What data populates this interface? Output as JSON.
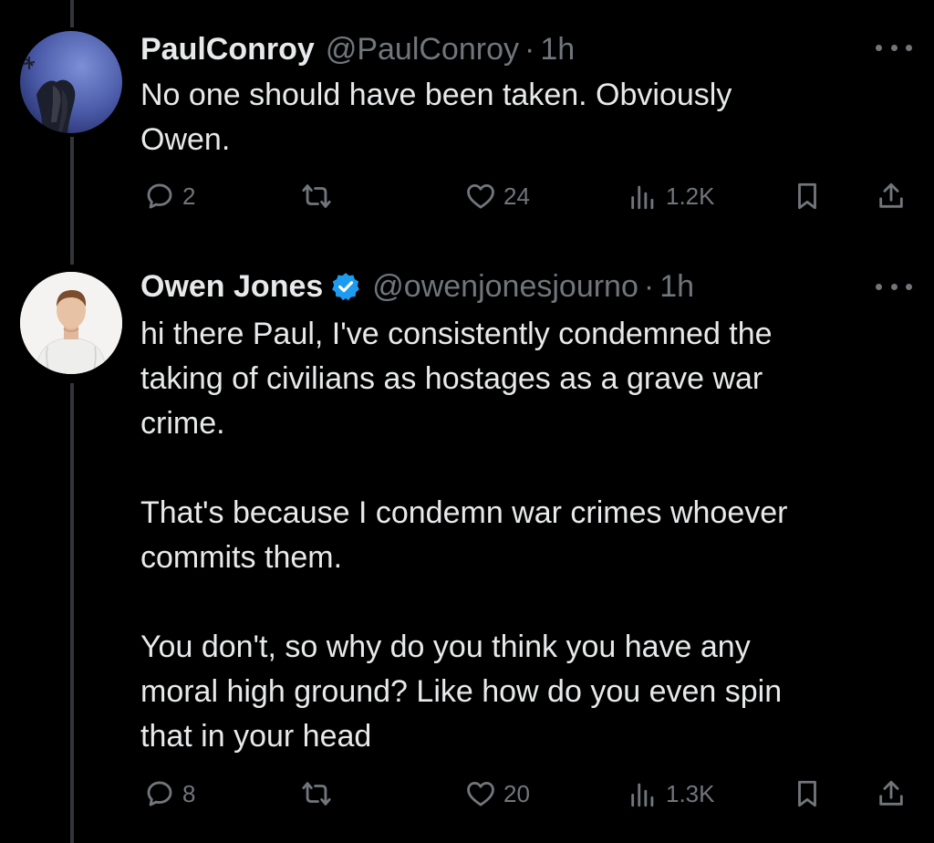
{
  "tweets": [
    {
      "display_name": "PaulConroy",
      "handle": "@PaulConroy",
      "separator": "·",
      "time": "1h",
      "verified": false,
      "paragraphs": [
        "No one should have been taken. Obviously\nOwen."
      ],
      "replies": "2",
      "retweets": "",
      "likes": "24",
      "views": "1.2K"
    },
    {
      "display_name": "Owen Jones",
      "handle": "@owenjonesjourno",
      "separator": "·",
      "time": "1h",
      "verified": true,
      "paragraphs": [
        "hi there Paul, I've consistently condemned the\ntaking of civilians as hostages as a grave war\ncrime.",
        "That's because I condemn war crimes whoever\ncommits them.",
        "You don't, so why do you think you have any\nmoral high ground? Like how do you even spin\nthat in your head"
      ],
      "replies": "8",
      "retweets": "",
      "likes": "20",
      "views": "1.3K"
    }
  ],
  "icons": {
    "reply": "reply-icon",
    "retweet": "retweet-icon",
    "like": "heart-icon",
    "views": "views-icon",
    "bookmark": "bookmark-icon",
    "share": "share-icon",
    "more": "more-icon",
    "verified": "verified-badge-icon"
  },
  "colors": {
    "background": "#000000",
    "text": "#e7e9ea",
    "secondary": "#71767b",
    "verified": "#1d9bf0"
  }
}
